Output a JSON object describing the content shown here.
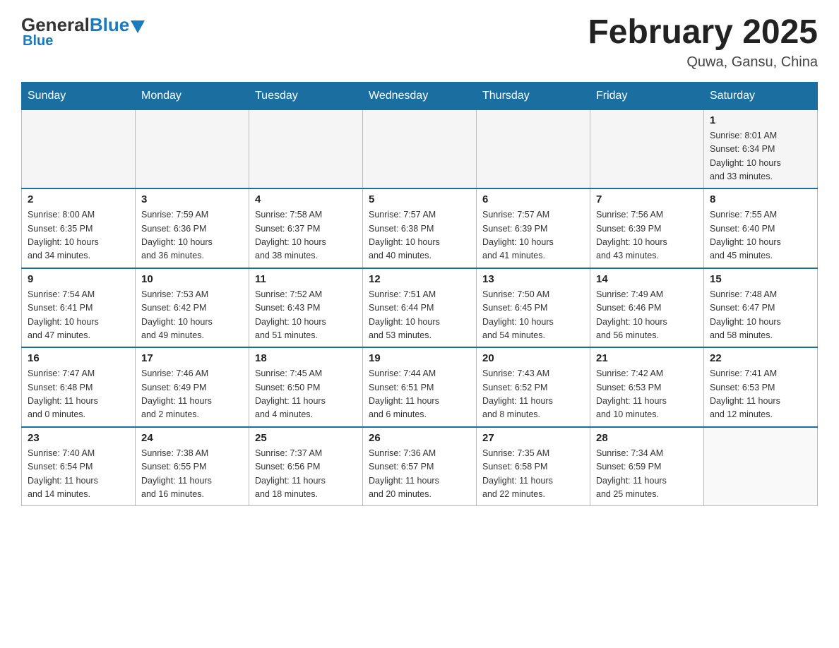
{
  "header": {
    "logo_general": "General",
    "logo_blue": "Blue",
    "month_title": "February 2025",
    "location": "Quwa, Gansu, China"
  },
  "days_of_week": [
    "Sunday",
    "Monday",
    "Tuesday",
    "Wednesday",
    "Thursday",
    "Friday",
    "Saturday"
  ],
  "weeks": [
    {
      "cells": [
        {
          "day": "",
          "info": ""
        },
        {
          "day": "",
          "info": ""
        },
        {
          "day": "",
          "info": ""
        },
        {
          "day": "",
          "info": ""
        },
        {
          "day": "",
          "info": ""
        },
        {
          "day": "",
          "info": ""
        },
        {
          "day": "1",
          "info": "Sunrise: 8:01 AM\nSunset: 6:34 PM\nDaylight: 10 hours\nand 33 minutes."
        }
      ]
    },
    {
      "cells": [
        {
          "day": "2",
          "info": "Sunrise: 8:00 AM\nSunset: 6:35 PM\nDaylight: 10 hours\nand 34 minutes."
        },
        {
          "day": "3",
          "info": "Sunrise: 7:59 AM\nSunset: 6:36 PM\nDaylight: 10 hours\nand 36 minutes."
        },
        {
          "day": "4",
          "info": "Sunrise: 7:58 AM\nSunset: 6:37 PM\nDaylight: 10 hours\nand 38 minutes."
        },
        {
          "day": "5",
          "info": "Sunrise: 7:57 AM\nSunset: 6:38 PM\nDaylight: 10 hours\nand 40 minutes."
        },
        {
          "day": "6",
          "info": "Sunrise: 7:57 AM\nSunset: 6:39 PM\nDaylight: 10 hours\nand 41 minutes."
        },
        {
          "day": "7",
          "info": "Sunrise: 7:56 AM\nSunset: 6:39 PM\nDaylight: 10 hours\nand 43 minutes."
        },
        {
          "day": "8",
          "info": "Sunrise: 7:55 AM\nSunset: 6:40 PM\nDaylight: 10 hours\nand 45 minutes."
        }
      ]
    },
    {
      "cells": [
        {
          "day": "9",
          "info": "Sunrise: 7:54 AM\nSunset: 6:41 PM\nDaylight: 10 hours\nand 47 minutes."
        },
        {
          "day": "10",
          "info": "Sunrise: 7:53 AM\nSunset: 6:42 PM\nDaylight: 10 hours\nand 49 minutes."
        },
        {
          "day": "11",
          "info": "Sunrise: 7:52 AM\nSunset: 6:43 PM\nDaylight: 10 hours\nand 51 minutes."
        },
        {
          "day": "12",
          "info": "Sunrise: 7:51 AM\nSunset: 6:44 PM\nDaylight: 10 hours\nand 53 minutes."
        },
        {
          "day": "13",
          "info": "Sunrise: 7:50 AM\nSunset: 6:45 PM\nDaylight: 10 hours\nand 54 minutes."
        },
        {
          "day": "14",
          "info": "Sunrise: 7:49 AM\nSunset: 6:46 PM\nDaylight: 10 hours\nand 56 minutes."
        },
        {
          "day": "15",
          "info": "Sunrise: 7:48 AM\nSunset: 6:47 PM\nDaylight: 10 hours\nand 58 minutes."
        }
      ]
    },
    {
      "cells": [
        {
          "day": "16",
          "info": "Sunrise: 7:47 AM\nSunset: 6:48 PM\nDaylight: 11 hours\nand 0 minutes."
        },
        {
          "day": "17",
          "info": "Sunrise: 7:46 AM\nSunset: 6:49 PM\nDaylight: 11 hours\nand 2 minutes."
        },
        {
          "day": "18",
          "info": "Sunrise: 7:45 AM\nSunset: 6:50 PM\nDaylight: 11 hours\nand 4 minutes."
        },
        {
          "day": "19",
          "info": "Sunrise: 7:44 AM\nSunset: 6:51 PM\nDaylight: 11 hours\nand 6 minutes."
        },
        {
          "day": "20",
          "info": "Sunrise: 7:43 AM\nSunset: 6:52 PM\nDaylight: 11 hours\nand 8 minutes."
        },
        {
          "day": "21",
          "info": "Sunrise: 7:42 AM\nSunset: 6:53 PM\nDaylight: 11 hours\nand 10 minutes."
        },
        {
          "day": "22",
          "info": "Sunrise: 7:41 AM\nSunset: 6:53 PM\nDaylight: 11 hours\nand 12 minutes."
        }
      ]
    },
    {
      "cells": [
        {
          "day": "23",
          "info": "Sunrise: 7:40 AM\nSunset: 6:54 PM\nDaylight: 11 hours\nand 14 minutes."
        },
        {
          "day": "24",
          "info": "Sunrise: 7:38 AM\nSunset: 6:55 PM\nDaylight: 11 hours\nand 16 minutes."
        },
        {
          "day": "25",
          "info": "Sunrise: 7:37 AM\nSunset: 6:56 PM\nDaylight: 11 hours\nand 18 minutes."
        },
        {
          "day": "26",
          "info": "Sunrise: 7:36 AM\nSunset: 6:57 PM\nDaylight: 11 hours\nand 20 minutes."
        },
        {
          "day": "27",
          "info": "Sunrise: 7:35 AM\nSunset: 6:58 PM\nDaylight: 11 hours\nand 22 minutes."
        },
        {
          "day": "28",
          "info": "Sunrise: 7:34 AM\nSunset: 6:59 PM\nDaylight: 11 hours\nand 25 minutes."
        },
        {
          "day": "",
          "info": ""
        }
      ]
    }
  ]
}
